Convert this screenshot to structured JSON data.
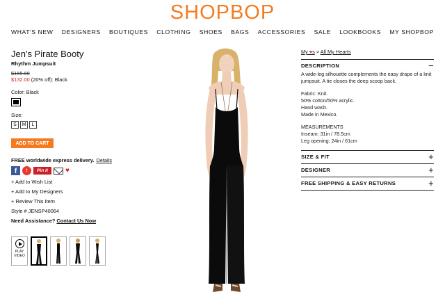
{
  "header": {
    "logo": "SHOPBOP",
    "nav": [
      "WHAT'S NEW",
      "DESIGNERS",
      "BOUTIQUES",
      "CLOTHING",
      "SHOES",
      "BAGS",
      "ACCESSORIES",
      "SALE",
      "LOOKBOOKS",
      "MY SHOPBOP"
    ]
  },
  "product": {
    "title": "Jen's Pirate Booty",
    "subtitle": "Rhythm Jumpsuit",
    "old_price": "$165.00",
    "sale_price": "$132.00",
    "discount_note": " (20% off): Black",
    "color_label": "Color: Black",
    "size_label": "Size:",
    "sizes": [
      "S",
      "M",
      "L"
    ],
    "add_to_cart": "ADD TO CART",
    "delivery": "FREE worldwide express delivery.",
    "details_link": "Details",
    "share": {
      "facebook": "f",
      "twitter": "t",
      "pinterest": "Pin it"
    },
    "wish_list": "+ Add to Wish List",
    "my_designers": "+ Add to My Designers",
    "review": "+ Review This Item",
    "style_no": "Style # JENSP40064",
    "assist": "Need Assistance?",
    "contact": "Contact Us Now",
    "play_video": "PLAY VIDEO",
    "dress_color": "#0b0b0b"
  },
  "panel": {
    "my_hearts_prefix": "My ",
    "my_hearts_suffix": "s",
    "separator": " > ",
    "all_hearts": "All My Hearts",
    "description_heading": "DESCRIPTION",
    "description_toggle": "−",
    "description_text": "A wide-leg silhouette complements the easy drape of a knit jumpsuit. A tie closes the deep scoop back.",
    "fabric_lines": [
      "Fabric: Knit.",
      "50% cotton/50% acrylic.",
      "Hand wash.",
      "Made in Mexico."
    ],
    "measure_lines": [
      "MEASUREMENTS",
      "Inseam: 31in / 78.5cm",
      "Leg opening: 24in / 61cm"
    ],
    "sections": [
      {
        "label": "SIZE & FIT",
        "toggle": "+"
      },
      {
        "label": "DESIGNER",
        "toggle": "+"
      },
      {
        "label": "FREE SHIPPING & EASY RETURNS",
        "toggle": "+"
      }
    ]
  }
}
